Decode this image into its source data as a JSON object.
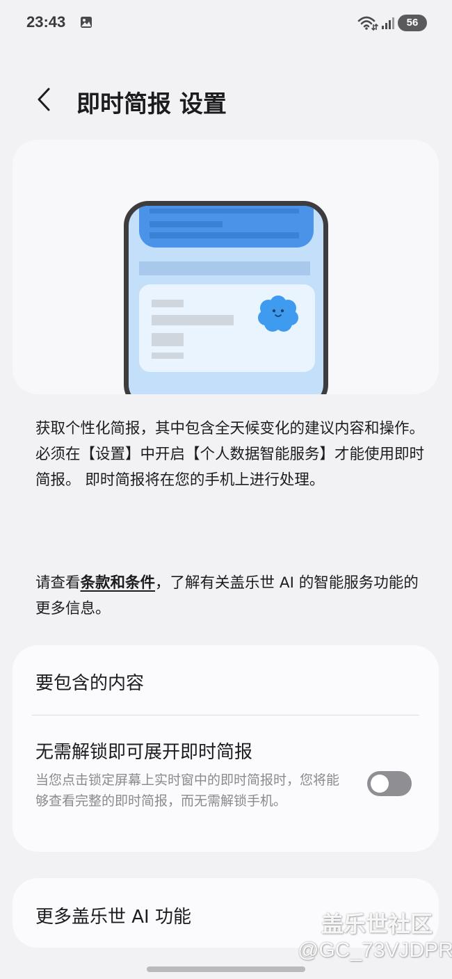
{
  "status_bar": {
    "time": "23:43",
    "battery": "56",
    "icons": [
      "photo-icon",
      "wifi-icon",
      "signal-icon"
    ]
  },
  "header": {
    "back_icon": "chevron-left-icon",
    "title": "即时简报 设置"
  },
  "description": {
    "para1_line1": "获取个性化简报，其中包含全天候变化的建议内容和操作。",
    "para1_line2": "必须在【设置】中开启【个人数据智能服务】才能使用即时简报。 即时简报将在您的手机上进行处理。",
    "para2_prefix": "请查看",
    "terms_link": "条款和条件",
    "para2_suffix": "，了解有关盖乐世 AI 的智能服务功能的更多信息。"
  },
  "settings": {
    "include_content": "要包含的内容",
    "unlock_title": "无需解锁即可展开即时简报",
    "unlock_subtitle": "当您点击锁定屏幕上实时窗中的即时简报时，您将能够查看完整的即时简报，而无需解锁手机。",
    "unlock_toggle_on": false
  },
  "more": {
    "title": "更多盖乐世 AI 功能"
  },
  "watermark": {
    "community": "盖乐世社区",
    "user": "@GC_73VJDPR"
  },
  "colors": {
    "background": "#f2f2f5",
    "card": "#fbfbfd",
    "toggle_off": "#8e8e93",
    "hero_blue": "#4a93e8"
  }
}
